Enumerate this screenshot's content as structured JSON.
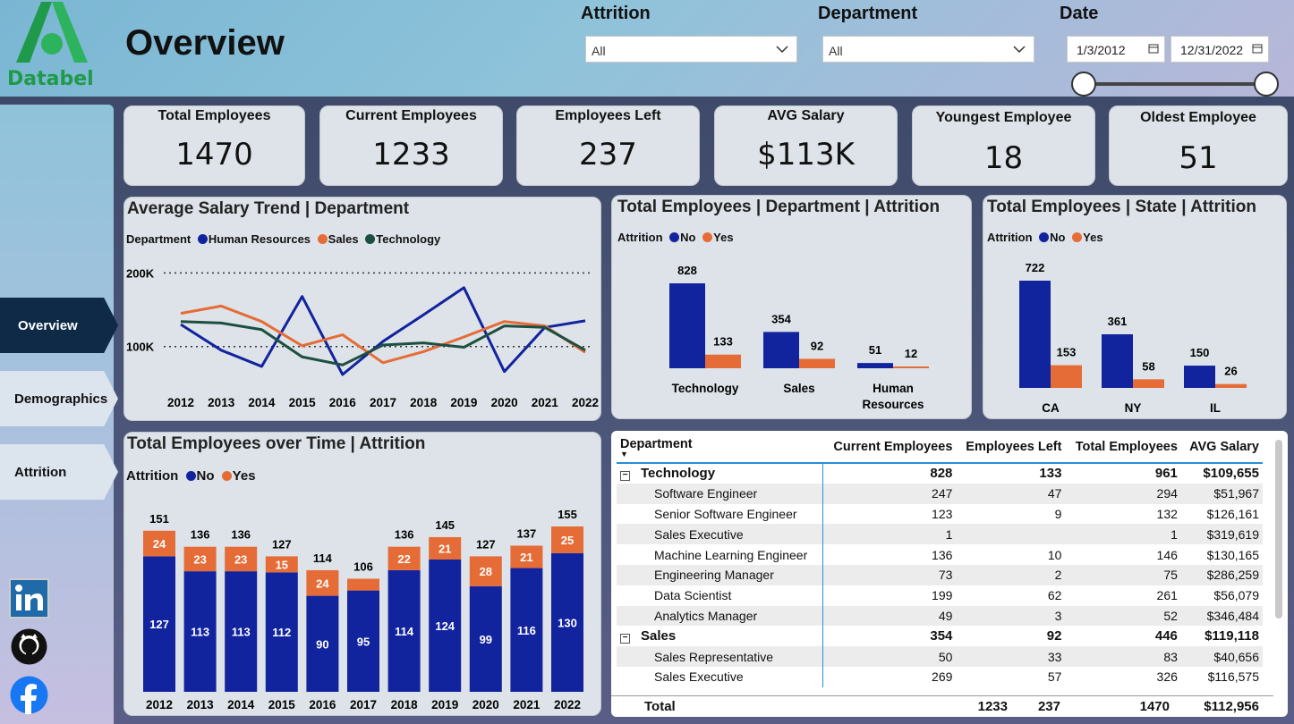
{
  "header": {
    "brand": "Databel",
    "title": "Overview",
    "filters": {
      "attrition_label": "Attrition",
      "attrition_value": "All",
      "department_label": "Department",
      "department_value": "All",
      "date_label": "Date",
      "date_start": "1/3/2012",
      "date_end": "12/31/2022"
    }
  },
  "nav": {
    "items": [
      {
        "label": "Overview",
        "active": true
      },
      {
        "label": "Demographics",
        "active": false
      },
      {
        "label": "Attrition",
        "active": false
      }
    ],
    "social": [
      "linkedin-icon",
      "github-icon",
      "facebook-icon"
    ]
  },
  "kpis": [
    {
      "title": "Total Employees",
      "value": "1470"
    },
    {
      "title": "Current Employees",
      "value": "1233"
    },
    {
      "title": "Employees Left",
      "value": "237"
    },
    {
      "title": "AVG Salary",
      "value": "$113K"
    },
    {
      "title": "Youngest Employee",
      "value": "18"
    },
    {
      "title": "Oldest Employee",
      "value": "51"
    }
  ],
  "colors": {
    "no": "#12239e",
    "yes": "#e66c37",
    "hr": "#12239e",
    "sales": "#e66c37",
    "technology": "#1c4f3f"
  },
  "chart_data": [
    {
      "type": "line",
      "title": "Average Salary Trend | Department",
      "legend_title": "Department",
      "x": [
        "2012",
        "2013",
        "2014",
        "2015",
        "2016",
        "2017",
        "2018",
        "2019",
        "2020",
        "2021",
        "2022"
      ],
      "series": [
        {
          "name": "Human Resources",
          "values": [
            130000,
            95000,
            73000,
            168000,
            62000,
            107000,
            143000,
            180000,
            66000,
            126000,
            135000
          ]
        },
        {
          "name": "Sales",
          "values": [
            145000,
            155000,
            134000,
            101000,
            116000,
            78000,
            93000,
            113000,
            134000,
            128000,
            92000
          ]
        },
        {
          "name": "Technology",
          "values": [
            134000,
            132000,
            123000,
            86000,
            75000,
            102000,
            105000,
            99000,
            128000,
            126000,
            95000
          ]
        }
      ],
      "yticks": [
        "200K",
        "100K"
      ],
      "ylim": [
        50000,
        210000
      ]
    },
    {
      "type": "bar",
      "title": "Total Employees | Department | Attrition",
      "legend_title": "Attrition",
      "categories": [
        "Technology",
        "Sales",
        "Human Resources"
      ],
      "series": [
        {
          "name": "No",
          "values": [
            828,
            354,
            51
          ]
        },
        {
          "name": "Yes",
          "values": [
            133,
            92,
            12
          ]
        }
      ]
    },
    {
      "type": "bar",
      "title": "Total Employees | State | Attrition",
      "legend_title": "Attrition",
      "categories": [
        "CA",
        "NY",
        "IL"
      ],
      "series": [
        {
          "name": "No",
          "values": [
            722,
            361,
            150
          ]
        },
        {
          "name": "Yes",
          "values": [
            153,
            58,
            26
          ]
        }
      ]
    },
    {
      "type": "bar",
      "title": "Total Employees over Time | Attrition",
      "legend_title": "Attrition",
      "stacked": true,
      "categories": [
        "2012",
        "2013",
        "2014",
        "2015",
        "2016",
        "2017",
        "2018",
        "2019",
        "2020",
        "2021",
        "2022"
      ],
      "series": [
        {
          "name": "No",
          "values": [
            127,
            113,
            113,
            112,
            90,
            95,
            114,
            124,
            99,
            116,
            130
          ]
        },
        {
          "name": "Yes",
          "values": [
            24,
            23,
            23,
            15,
            24,
            11,
            22,
            21,
            28,
            21,
            25
          ]
        }
      ],
      "totals": [
        151,
        136,
        136,
        127,
        114,
        106,
        136,
        145,
        127,
        137,
        155
      ]
    }
  ],
  "table": {
    "columns": [
      "Department",
      "Current Employees",
      "Employees Left",
      "Total Employees",
      "AVG Salary"
    ],
    "rows": [
      {
        "kind": "grp",
        "cells": [
          "Technology",
          "828",
          "133",
          "961",
          "$109,655"
        ]
      },
      {
        "kind": "sub",
        "cells": [
          "Software Engineer",
          "247",
          "47",
          "294",
          "$51,967"
        ]
      },
      {
        "kind": "sub",
        "cells": [
          "Senior Software Engineer",
          "123",
          "9",
          "132",
          "$126,161"
        ]
      },
      {
        "kind": "sub",
        "cells": [
          "Sales Executive",
          "1",
          "",
          "1",
          "$319,619"
        ]
      },
      {
        "kind": "sub",
        "cells": [
          "Machine Learning Engineer",
          "136",
          "10",
          "146",
          "$130,165"
        ]
      },
      {
        "kind": "sub",
        "cells": [
          "Engineering Manager",
          "73",
          "2",
          "75",
          "$286,259"
        ]
      },
      {
        "kind": "sub",
        "cells": [
          "Data Scientist",
          "199",
          "62",
          "261",
          "$56,079"
        ]
      },
      {
        "kind": "sub",
        "cells": [
          "Analytics Manager",
          "49",
          "3",
          "52",
          "$346,484"
        ]
      },
      {
        "kind": "grp",
        "cells": [
          "Sales",
          "354",
          "92",
          "446",
          "$119,118"
        ]
      },
      {
        "kind": "sub",
        "cells": [
          "Sales Representative",
          "50",
          "33",
          "83",
          "$40,656"
        ]
      },
      {
        "kind": "sub",
        "cells": [
          "Sales Executive",
          "269",
          "57",
          "326",
          "$116,575"
        ]
      }
    ],
    "total": [
      "Total",
      "1233",
      "237",
      "1470",
      "$112,956"
    ]
  }
}
